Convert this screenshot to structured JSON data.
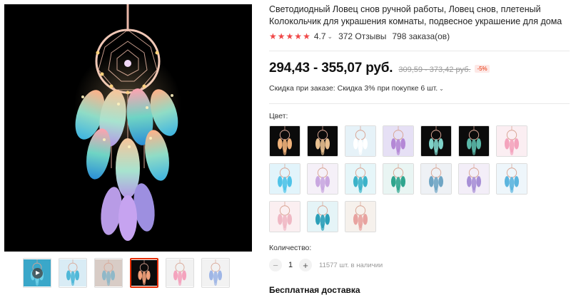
{
  "product": {
    "title": "Светодиодный Ловец снов ручной работы, Ловец снов, плетеный Колокольчик для украшения комнаты, подвесное украшение для дома",
    "rating": "4.7",
    "reviews": "372 Отзывы",
    "orders": "798 заказа(ов)",
    "price": "294,43 - 355,07 руб.",
    "old_price": "309,59 - 373,42 руб.",
    "discount": "-5%",
    "bulk_discount": "Скидка при заказе: Скидка 3% при покупке 6 шт."
  },
  "colors": {
    "label": "Цвет:",
    "options": [
      {
        "icon": "dreamcatcher-swatch-icon",
        "bg": "#0b0b0b",
        "feather": "#f0b27a"
      },
      {
        "icon": "dreamcatcher-swatch-icon",
        "bg": "#0b0b0b",
        "feather": "#e8c090"
      },
      {
        "icon": "dreamcatcher-swatch-icon",
        "bg": "#e6f2f8",
        "feather": "#ffffff"
      },
      {
        "icon": "dreamcatcher-swatch-icon",
        "bg": "#e6e0f5",
        "feather": "#b487d6"
      },
      {
        "icon": "dreamcatcher-swatch-icon",
        "bg": "#0b0b0b",
        "feather": "#7fd3c9"
      },
      {
        "icon": "dreamcatcher-swatch-icon",
        "bg": "#0b0b0b",
        "feather": "#5ab8a8"
      },
      {
        "icon": "dreamcatcher-swatch-icon",
        "bg": "#fbeef2",
        "feather": "#f4a3bd"
      },
      {
        "icon": "dreamcatcher-swatch-icon",
        "bg": "#e2f4fb",
        "feather": "#4fc3e8"
      },
      {
        "icon": "dreamcatcher-swatch-icon",
        "bg": "#f5f0f8",
        "feather": "#c9a7e0"
      },
      {
        "icon": "dreamcatcher-swatch-icon",
        "bg": "#e6f6f9",
        "feather": "#3bb3c9"
      },
      {
        "icon": "dreamcatcher-swatch-icon",
        "bg": "#e9f5f3",
        "feather": "#2fa58e"
      },
      {
        "icon": "dreamcatcher-swatch-icon",
        "bg": "#eef1f5",
        "feather": "#6fa5c4"
      },
      {
        "icon": "dreamcatcher-swatch-icon",
        "bg": "#f3eef8",
        "feather": "#a78fd6"
      },
      {
        "icon": "dreamcatcher-swatch-icon",
        "bg": "#eef6fb",
        "feather": "#5bb5de"
      },
      {
        "icon": "dreamcatcher-swatch-icon",
        "bg": "#fbeff1",
        "feather": "#efb8c4"
      },
      {
        "icon": "dreamcatcher-swatch-icon",
        "bg": "#e5f4f7",
        "feather": "#2a9fb8"
      },
      {
        "icon": "dreamcatcher-swatch-icon",
        "bg": "#f6f1ec",
        "feather": "#e8a3a0"
      }
    ]
  },
  "quantity": {
    "label": "Количество:",
    "minus": "−",
    "value": "1",
    "plus": "+",
    "stock": "11577 шт. в наличии"
  },
  "shipping": "Бесплатная доставка",
  "gallery": {
    "thumbs": [
      {
        "icon": "video-thumbnail-icon",
        "bg": "#3aa7c9",
        "feather": "#6fd0e8"
      },
      {
        "icon": "dreamcatcher-thumbnail-icon",
        "bg": "#d9ecf5",
        "feather": "#4fb8d8"
      },
      {
        "icon": "dreamcatcher-thumbnail-icon",
        "bg": "#d8ccc6",
        "feather": "#8fb8c8"
      },
      {
        "icon": "dreamcatcher-thumbnail-icon",
        "bg": "#0b0b0b",
        "feather": "#f0a07a"
      },
      {
        "icon": "dreamcatcher-thumbnail-icon",
        "bg": "#f1f1f1",
        "feather": "#f4a3bd"
      },
      {
        "icon": "dreamcatcher-thumbnail-icon",
        "bg": "#f2f2f2",
        "feather": "#9fb6e6"
      }
    ]
  },
  "colors_theme": {
    "accent": "#e62e04",
    "star": "#f04848"
  }
}
